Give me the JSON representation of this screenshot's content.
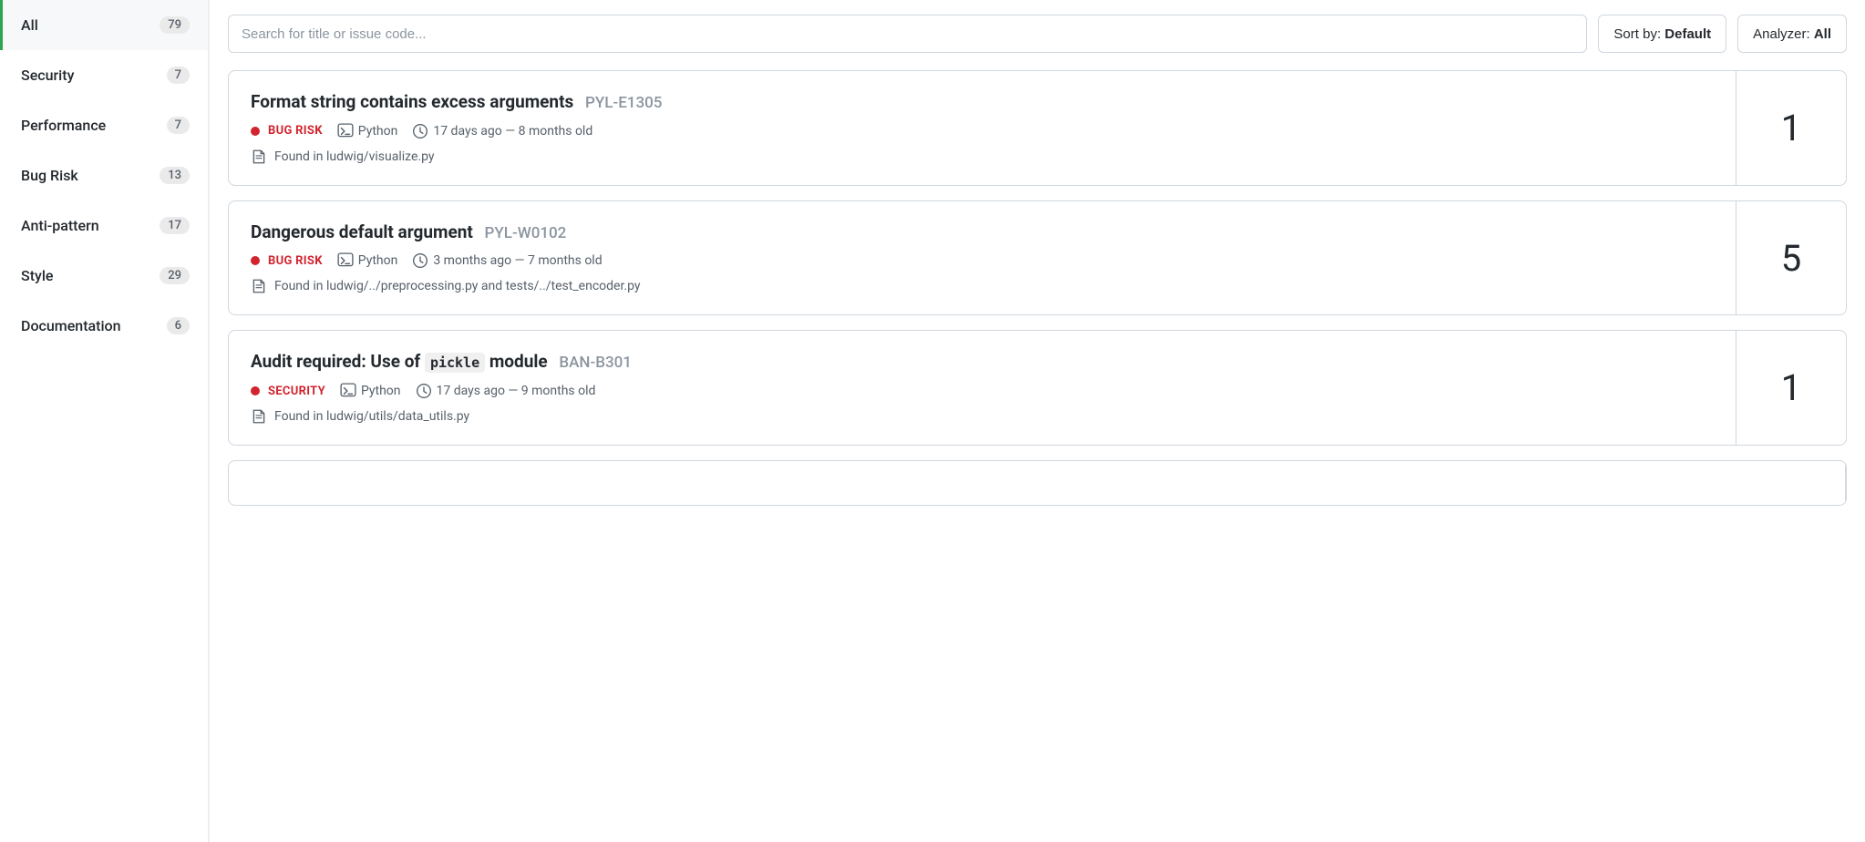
{
  "sidebar": {
    "items": [
      {
        "label": "All",
        "count": "79",
        "active": true
      },
      {
        "label": "Security",
        "count": "7",
        "active": false
      },
      {
        "label": "Performance",
        "count": "7",
        "active": false
      },
      {
        "label": "Bug Risk",
        "count": "13",
        "active": false
      },
      {
        "label": "Anti-pattern",
        "count": "17",
        "active": false
      },
      {
        "label": "Style",
        "count": "29",
        "active": false
      },
      {
        "label": "Documentation",
        "count": "6",
        "active": false
      }
    ]
  },
  "topbar": {
    "search_placeholder": "Search for title or issue code...",
    "sort_button": "Sort by: ",
    "sort_value": "Default",
    "analyzer_button": "Analyzer: ",
    "analyzer_value": "All"
  },
  "issues": [
    {
      "title": "Format string contains excess arguments",
      "code": "PYL-E1305",
      "badge_type": "BUG RISK",
      "badge_class": "badge-bug-risk",
      "language": "Python",
      "time": "17 days ago — 8 months old",
      "file": "Found in ludwig/visualize.py",
      "count": "1"
    },
    {
      "title": "Dangerous default argument",
      "code": "PYL-W0102",
      "badge_type": "BUG RISK",
      "badge_class": "badge-bug-risk",
      "language": "Python",
      "time": "3 months ago — 7 months old",
      "file": "Found in ludwig/../preprocessing.py and tests/../test_encoder.py",
      "count": "5"
    },
    {
      "title_prefix": "Audit required: Use of ",
      "title_code": "pickle",
      "title_suffix": " module",
      "code": "BAN-B301",
      "badge_type": "SECURITY",
      "badge_class": "badge-security",
      "language": "Python",
      "time": "17 days ago — 9 months old",
      "file": "Found in ludwig/utils/data_utils.py",
      "count": "1",
      "has_inline_code": true
    }
  ]
}
